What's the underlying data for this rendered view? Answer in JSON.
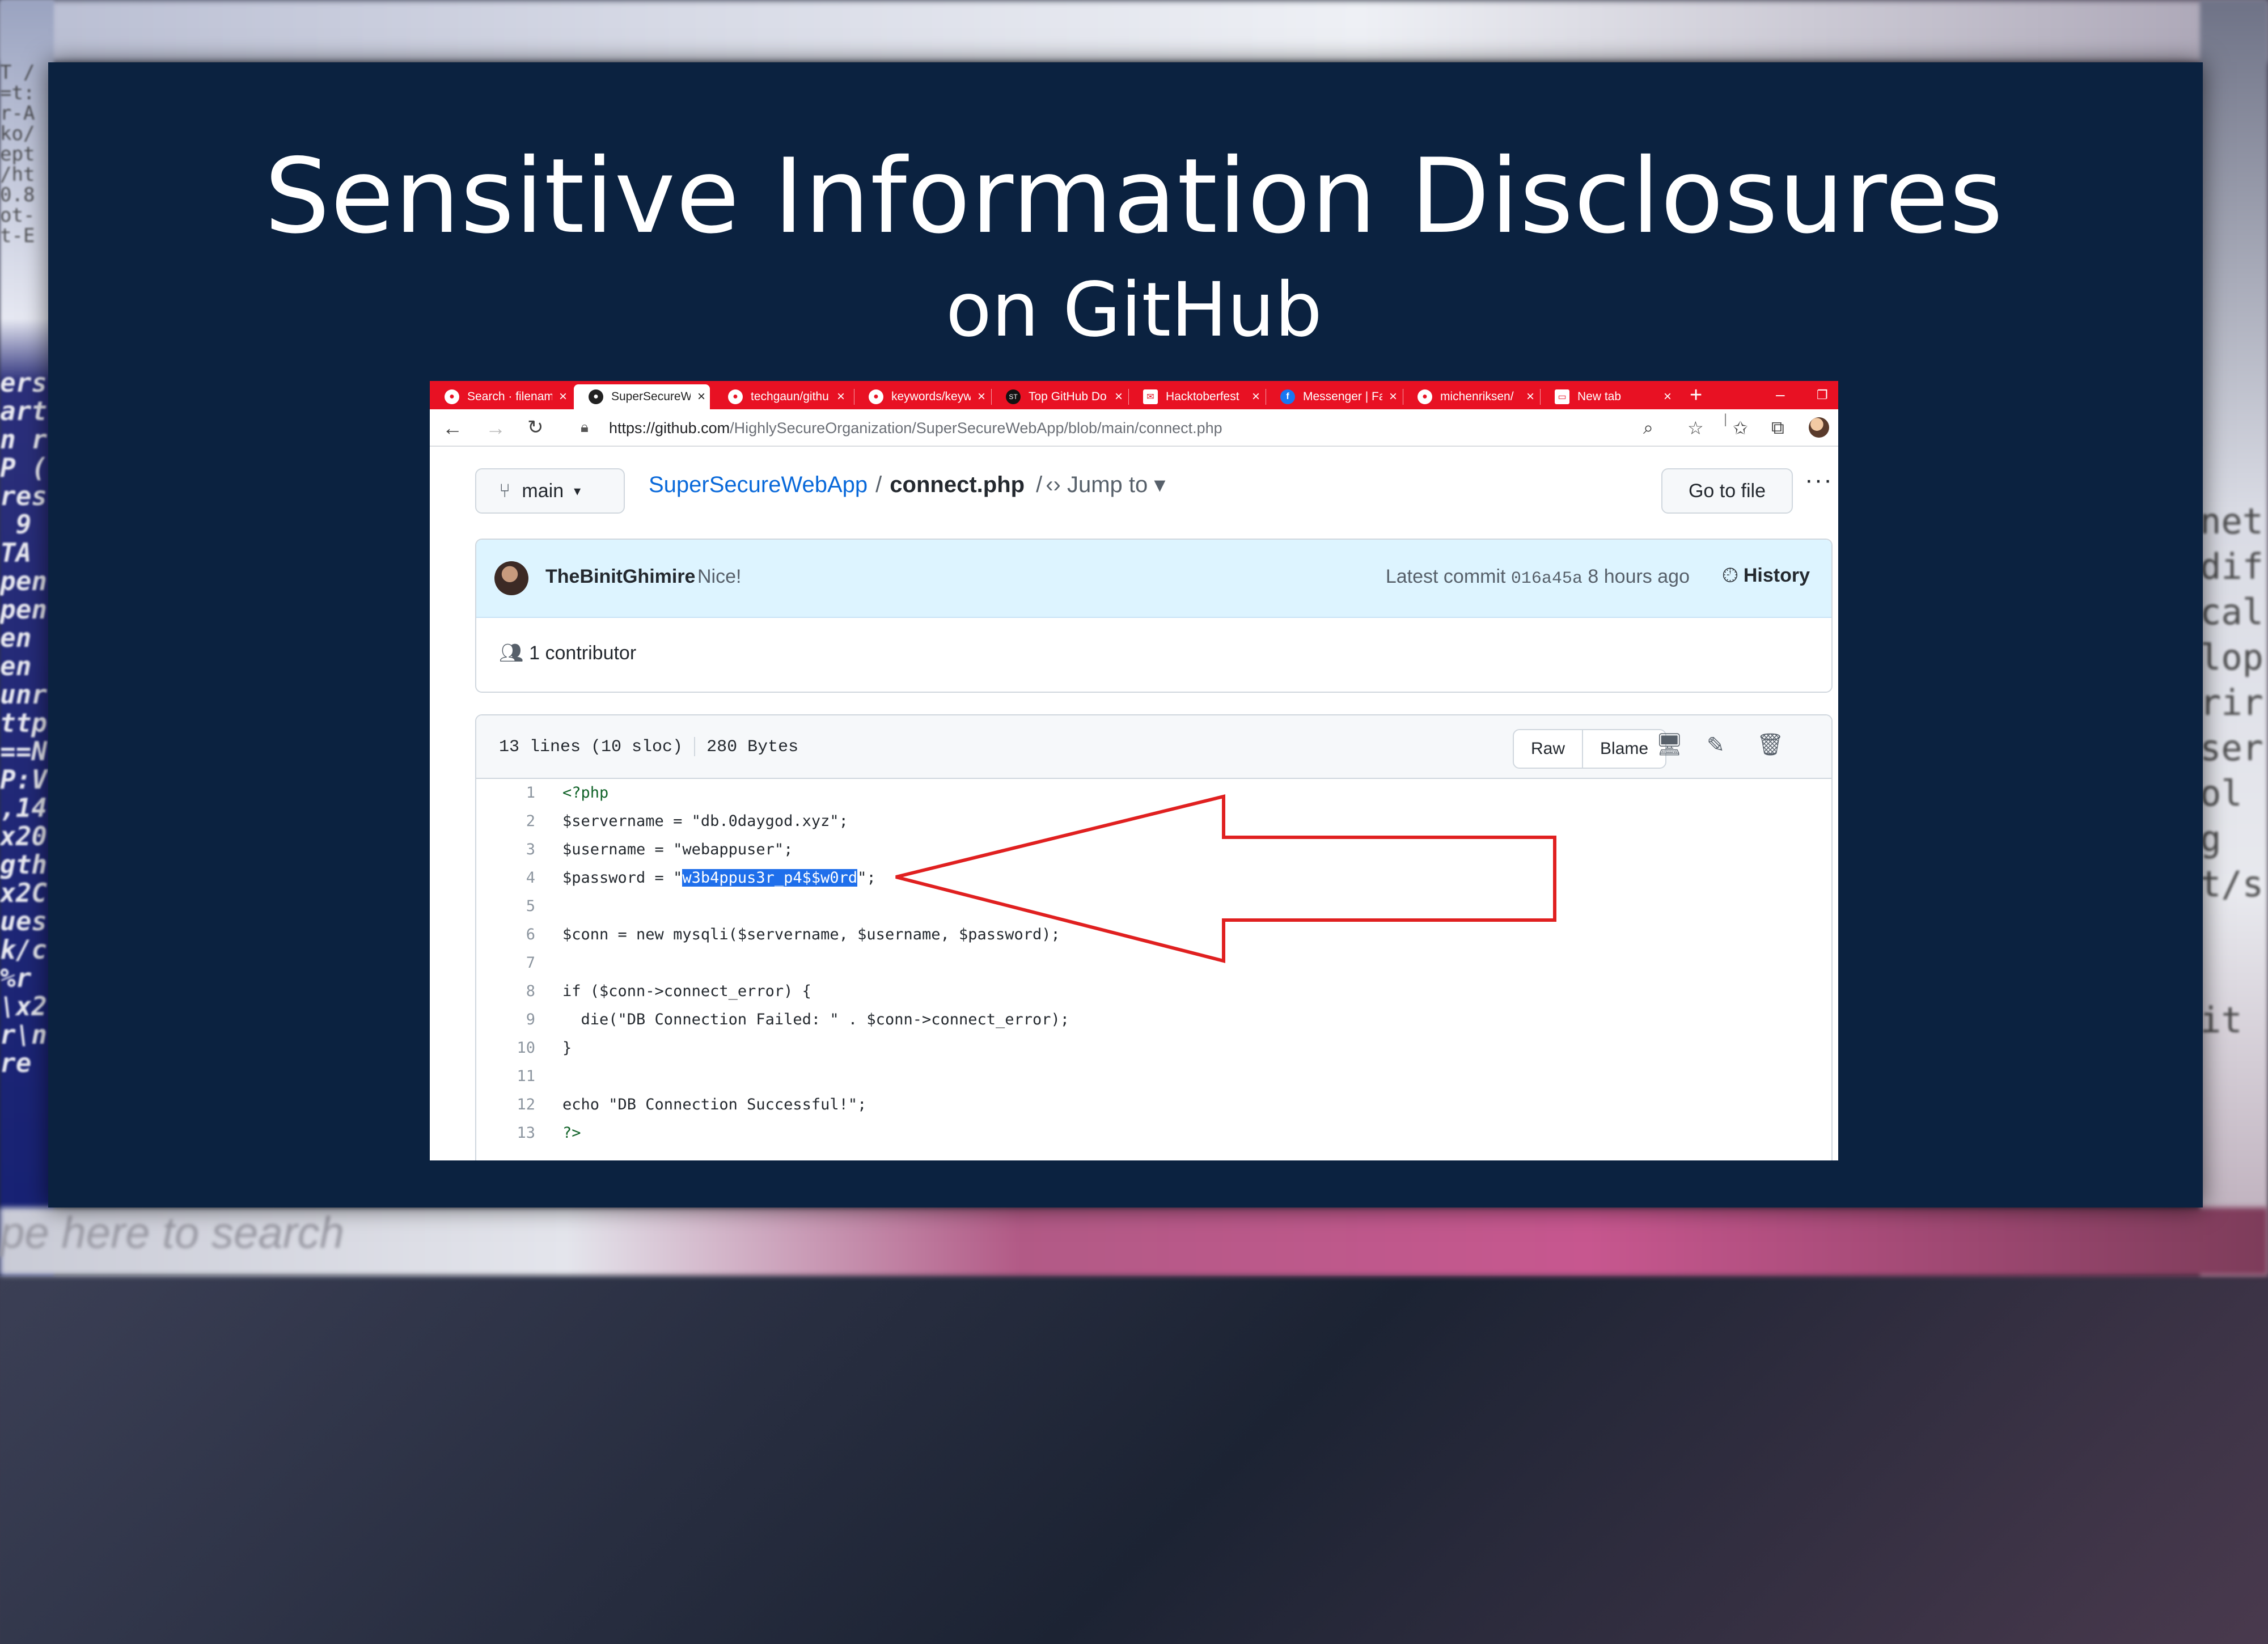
{
  "slide": {
    "title": "Sensitive Information Disclosures",
    "subtitle": "on GitHub"
  },
  "browser": {
    "tabs": [
      {
        "label": "Search · filenam",
        "icon": "github-icon",
        "active": false
      },
      {
        "label": "SuperSecureWe",
        "icon": "github-icon",
        "active": true
      },
      {
        "label": "techgaun/githu",
        "icon": "github-icon",
        "active": false
      },
      {
        "label": "keywords/keyw",
        "icon": "github-icon",
        "active": false
      },
      {
        "label": "Top GitHub Do",
        "icon": "st-icon",
        "active": false
      },
      {
        "label": "Hacktoberfest",
        "icon": "mail-icon",
        "active": false
      },
      {
        "label": "Messenger | Fa",
        "icon": "facebook-icon",
        "active": false
      },
      {
        "label": "michenriksen/",
        "icon": "github-icon",
        "active": false
      },
      {
        "label": "New tab",
        "icon": "new-tab-icon",
        "active": false
      }
    ],
    "url_base": "https://github.com",
    "url_path": "/HighlySecureOrganization/SuperSecureWebApp/blob/main/connect.php",
    "accent_color": "#e81123"
  },
  "repo": {
    "branch": "main",
    "name": "SuperSecureWebApp",
    "file": "connect.php",
    "jump_to": "Jump to",
    "go_to_file": "Go to file"
  },
  "commit": {
    "author": "TheBinitGhimire",
    "message": "Nice!",
    "latest_label": "Latest commit",
    "sha": "016a45a",
    "time": "8 hours ago",
    "history": "History",
    "contributors": "1 contributor"
  },
  "file": {
    "lines_info": "13 lines (10 sloc)",
    "size": "280 Bytes",
    "raw": "Raw",
    "blame": "Blame"
  },
  "code_lines": [
    {
      "n": "1",
      "text": "<?php"
    },
    {
      "n": "2",
      "text": "$servername = \"db.0daygod.xyz\";"
    },
    {
      "n": "3",
      "text": "$username = \"webappuser\";"
    },
    {
      "n": "4",
      "text": "$password = \"w3b4ppus3r_p4$$w0rd\";"
    },
    {
      "n": "5",
      "text": ""
    },
    {
      "n": "6",
      "text": "$conn = new mysqli($servername, $username, $password);"
    },
    {
      "n": "7",
      "text": ""
    },
    {
      "n": "8",
      "text": "if ($conn->connect_error) {"
    },
    {
      "n": "9",
      "text": "  die(\"DB Connection Failed: \" . $conn->connect_error);"
    },
    {
      "n": "10",
      "text": "}"
    },
    {
      "n": "11",
      "text": ""
    },
    {
      "n": "12",
      "text": "echo \"DB Connection Successful!\";"
    },
    {
      "n": "13",
      "text": "?>"
    }
  ],
  "highlight": {
    "password_value": "w3b4ppus3r_p4$$w0rd",
    "arrow_color": "#e02020"
  }
}
